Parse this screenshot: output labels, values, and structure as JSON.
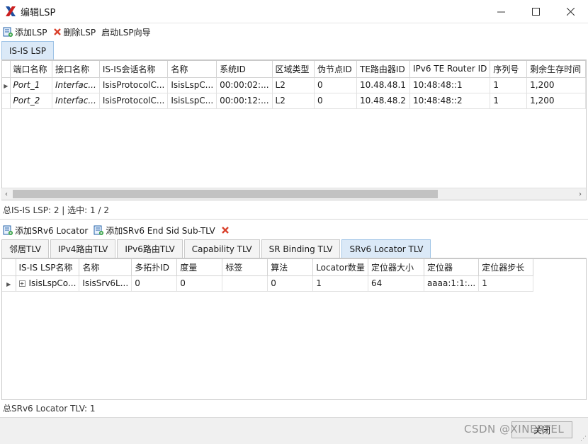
{
  "window": {
    "title": "编辑LSP",
    "minimize_glyph": "—",
    "maximize_glyph": "☐",
    "close_glyph": "✕"
  },
  "toolbar": {
    "add_lsp": "添加LSP",
    "delete_lsp": "删除LSP",
    "wizard": "启动LSP向导"
  },
  "lsp_tab": {
    "label": "IS-IS LSP"
  },
  "lsp_table": {
    "columns": [
      "端口名称",
      "接口名称",
      "IS-IS会话名称",
      "名称",
      "系统ID",
      "区域类型",
      "伪节点ID",
      "TE路由器ID",
      "IPv6 TE Router ID",
      "序列号",
      "剩余生存时间"
    ],
    "rows": [
      [
        "Port_1",
        "Interfac...",
        "IsisProtocolC...",
        "IsisLspC...",
        "00:00:02:...",
        "L2",
        "0",
        "10.48.48.1",
        "10:48:48::1",
        "1",
        "1,200"
      ],
      [
        "Port_2",
        "Interfac...",
        "IsisProtocolC...",
        "IsisLspC...",
        "00:00:12:...",
        "L2",
        "0",
        "10.48.48.2",
        "10:48:48::2",
        "1",
        "1,200"
      ]
    ]
  },
  "lsp_status": "总IS-IS LSP: 2 | 选中: 1 / 2",
  "tlv_toolbar": {
    "add_locator": "添加SRv6 Locator",
    "add_end_sid": "添加SRv6 End Sid Sub-TLV"
  },
  "tlv_tabs": [
    "邻居TLV",
    "IPv4路由TLV",
    "IPv6路由TLV",
    "Capability TLV",
    "SR Binding TLV",
    "SRv6 Locator TLV"
  ],
  "locator_table": {
    "columns": [
      "IS-IS LSP名称",
      "名称",
      "多拓扑ID",
      "度量",
      "标签",
      "算法",
      "Locator数量",
      "定位器大小",
      "定位器",
      "定位器步长"
    ],
    "rows": [
      [
        "IsisLspCo...",
        "IsisSrv6L...",
        "0",
        "0",
        "",
        "0",
        "1",
        "64",
        "aaaa:1:1:...",
        "1"
      ]
    ]
  },
  "locator_status": "总SRv6 Locator TLV: 1",
  "footer": {
    "close_label": "关闭"
  },
  "watermark": "CSDN @XINERTEL",
  "colors": {
    "accent": "#1f5fa8",
    "tab_active": "#dbe9f7",
    "delete_red": "#d9412c",
    "logo_red": "#cc1f1f",
    "logo_blue": "#1f4fa0"
  }
}
